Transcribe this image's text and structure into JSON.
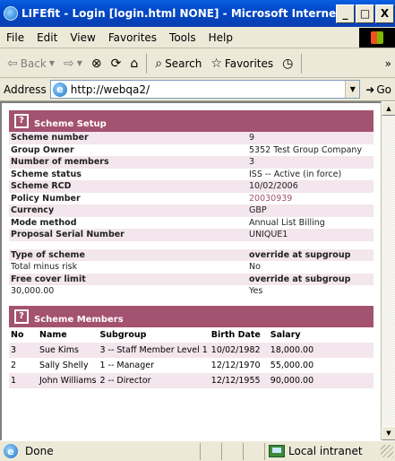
{
  "window": {
    "title": "LIFEfit - Login [login.html NONE] - Microsoft Internet Ex...",
    "min": "_",
    "max": "□",
    "close": "X"
  },
  "menu": [
    "File",
    "Edit",
    "View",
    "Favorites",
    "Tools",
    "Help"
  ],
  "toolbar": {
    "back": "Back",
    "search": "Search",
    "favorites": "Favorites",
    "more": "»"
  },
  "address": {
    "label": "Address",
    "url": "http://webqa2/",
    "go": "Go"
  },
  "scheme_setup": {
    "title": "Scheme Setup",
    "rows": [
      {
        "label": "Scheme number",
        "value": "9"
      },
      {
        "label": "Group Owner",
        "value": "5352 Test Group Company"
      },
      {
        "label": "Number of members",
        "value": "3"
      },
      {
        "label": "Scheme status",
        "value": "ISS -- Active (in force)"
      },
      {
        "label": "Scheme RCD",
        "value": "10/02/2006"
      },
      {
        "label": "Policy Number",
        "value": "20030939"
      },
      {
        "label": "Currency",
        "value": "GBP"
      },
      {
        "label": "Mode method",
        "value": "Annual List Billing"
      },
      {
        "label": "Proposal Serial Number",
        "value": "UNIQUE1"
      }
    ],
    "rows2": [
      {
        "label": "Type of scheme",
        "value": "override at supgroup"
      },
      {
        "label": "Total minus risk",
        "value": "No"
      },
      {
        "label": "Free cover limit",
        "value": "override at subgroup"
      },
      {
        "label": "30,000.00",
        "value": "Yes"
      }
    ]
  },
  "scheme_members": {
    "title": "Scheme Members",
    "headers": [
      "No",
      "Name",
      "Subgroup",
      "Birth Date",
      "Salary"
    ],
    "rows": [
      [
        "3",
        "Sue Kims",
        "3 -- Staff Member Level 1",
        "10/02/1982",
        "18,000.00"
      ],
      [
        "2",
        "Sally Shelly",
        "1 -- Manager",
        "12/12/1970",
        "55,000.00"
      ],
      [
        "1",
        "John Williams",
        "2 -- Director",
        "12/12/1955",
        "90,000.00"
      ]
    ]
  },
  "status": {
    "text": "Done",
    "zone": "Local intranet"
  }
}
